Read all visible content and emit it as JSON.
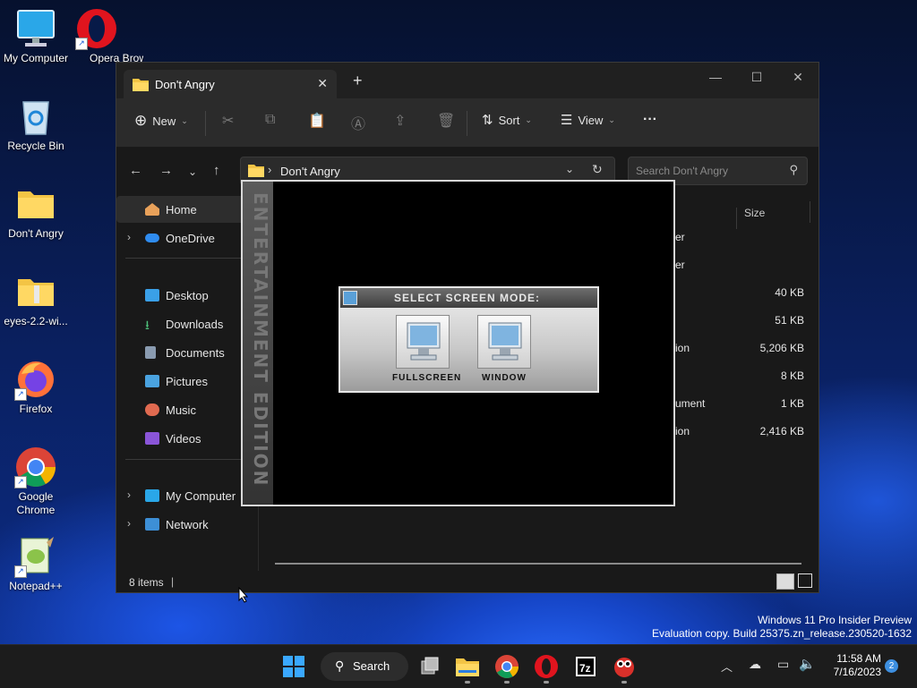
{
  "desktop": {
    "icons": [
      {
        "label": "My Computer"
      },
      {
        "label": "Opera Browser"
      },
      {
        "label": "Recycle Bin"
      },
      {
        "label": "Don't Angry"
      },
      {
        "label": "eyes-2.2-wi..."
      },
      {
        "label": "Firefox"
      },
      {
        "label": "Google Chrome"
      },
      {
        "label": "Notepad++"
      }
    ],
    "watermark": {
      "line1": "Windows 11 Pro Insider Preview",
      "line2": "Evaluation copy. Build 25375.zn_release.230520-1632"
    }
  },
  "explorer": {
    "tab_title": "Don't Angry",
    "new_tab_icon": "plus-icon",
    "toolbar": {
      "new_label": "New",
      "sort_label": "Sort",
      "view_label": "View",
      "more_icon": "ellipsis-icon"
    },
    "address": {
      "path": "Don't Angry",
      "search_placeholder": "Search Don't Angry"
    },
    "sidebar": {
      "home": "Home",
      "onedrive": "OneDrive",
      "desktop": "Desktop",
      "downloads": "Downloads",
      "documents": "Documents",
      "pictures": "Pictures",
      "music": "Music",
      "videos": "Videos",
      "my_computer": "My Computer",
      "network": "Network"
    },
    "columns": {
      "size": "Size"
    },
    "rows": [
      {
        "type": "er",
        "size": ""
      },
      {
        "type": "er",
        "size": ""
      },
      {
        "type": "",
        "size": "40 KB"
      },
      {
        "type": "",
        "size": "51 KB"
      },
      {
        "type": "ion",
        "size": "5,206 KB"
      },
      {
        "type": "",
        "size": "8 KB"
      },
      {
        "type": "ument",
        "size": "1 KB"
      },
      {
        "type": "ion",
        "size": "2,416 KB"
      }
    ],
    "status": {
      "items": "8 items"
    }
  },
  "game": {
    "side_text": "ENTERTAINMENT EDITION",
    "dialog_title": "SELECT SCREEN MODE:",
    "fullscreen_label": "FULLSCREEN",
    "window_label": "WINDOW"
  },
  "taskbar": {
    "search_label": "Search",
    "time": "11:58 AM",
    "date": "7/16/2023",
    "notification_count": "2"
  }
}
